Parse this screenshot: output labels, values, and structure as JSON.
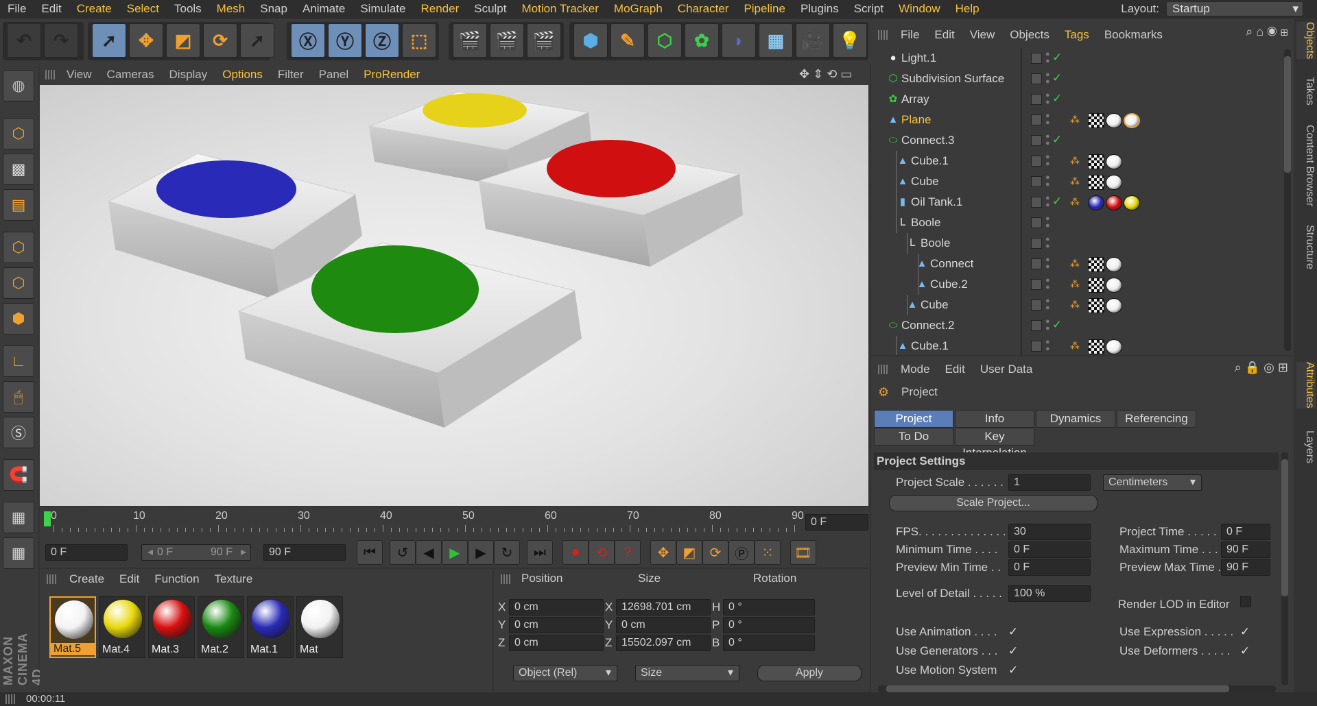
{
  "menubar": {
    "items": [
      "File",
      "Edit",
      "Create",
      "Select",
      "Tools",
      "Mesh",
      "Snap",
      "Animate",
      "Simulate",
      "Render",
      "Sculpt",
      "Motion Tracker",
      "MoGraph",
      "Character",
      "Pipeline",
      "Plugins",
      "Script",
      "Window",
      "Help"
    ],
    "highlighted": [
      "Create",
      "Select",
      "Mesh",
      "Render",
      "Motion Tracker",
      "MoGraph",
      "Character",
      "Pipeline",
      "Window",
      "Help"
    ],
    "layout_label": "Layout:",
    "layout_value": "Startup"
  },
  "viewport_menu": {
    "items": [
      "View",
      "Cameras",
      "Display",
      "Options",
      "Filter",
      "Panel",
      "ProRender"
    ],
    "highlighted": [
      "Options",
      "ProRender"
    ]
  },
  "scene": {
    "discs": [
      {
        "name": "blue-disc",
        "color": "#2a2ab8"
      },
      {
        "name": "yellow-disc",
        "color": "#e6d21a"
      },
      {
        "name": "red-disc",
        "color": "#d01010"
      },
      {
        "name": "green-disc",
        "color": "#1f8a10"
      }
    ]
  },
  "timeline": {
    "ticks": [
      "0",
      "10",
      "20",
      "30",
      "40",
      "50",
      "60",
      "70",
      "80",
      "90"
    ],
    "current_frame": "0 F"
  },
  "transport": {
    "start": "0 F",
    "range_start": "0 F",
    "range_end": "90 F",
    "end": "90 F"
  },
  "material_manager": {
    "menu": [
      "Create",
      "Edit",
      "Function",
      "Texture"
    ],
    "materials": [
      {
        "name": "Mat.5",
        "color": "#f2f2f2",
        "selected": true
      },
      {
        "name": "Mat.4",
        "color": "#e8d80a",
        "selected": false
      },
      {
        "name": "Mat.3",
        "color": "#d81010",
        "selected": false
      },
      {
        "name": "Mat.2",
        "color": "#1a8a12",
        "selected": false
      },
      {
        "name": "Mat.1",
        "color": "#2a2ab8",
        "selected": false
      },
      {
        "name": "Mat",
        "color": "#f2f2f2",
        "selected": false
      }
    ]
  },
  "coordinates": {
    "headers": {
      "position": "Position",
      "size": "Size",
      "rotation": "Rotation"
    },
    "rows": [
      {
        "axis": "X",
        "pos": "0 cm",
        "saxis": "X",
        "size": "12698.701 cm",
        "raxis": "H",
        "rot": "0 °"
      },
      {
        "axis": "Y",
        "pos": "0 cm",
        "saxis": "Y",
        "size": "0 cm",
        "raxis": "P",
        "rot": "0 °"
      },
      {
        "axis": "Z",
        "pos": "0 cm",
        "saxis": "Z",
        "size": "15502.097 cm",
        "raxis": "B",
        "rot": "0 °"
      }
    ],
    "mode_select": "Object (Rel)",
    "size_select": "Size",
    "apply": "Apply"
  },
  "object_manager": {
    "menu": [
      "File",
      "Edit",
      "View",
      "Objects",
      "Tags",
      "Bookmarks"
    ],
    "highlighted": [
      "Tags"
    ],
    "objects": [
      {
        "name": "Light.1",
        "indent": 0,
        "icon": "light-icon",
        "tags": [],
        "check": true,
        "selected": false
      },
      {
        "name": "Subdivision Surface",
        "indent": 0,
        "icon": "subdivision-icon",
        "tags": [],
        "check": true,
        "selected": false
      },
      {
        "name": "Array",
        "indent": 0,
        "icon": "array-icon",
        "tags": [],
        "check": true,
        "selected": false
      },
      {
        "name": "Plane",
        "indent": 0,
        "icon": "polygon-icon",
        "tags": [
          "phong",
          "checker",
          "#eeeeee",
          "#eeeeee"
        ],
        "check": false,
        "selected": true
      },
      {
        "name": "Connect.3",
        "indent": 0,
        "icon": "connect-icon",
        "tags": [],
        "check": true,
        "selected": false
      },
      {
        "name": "Cube.1",
        "indent": 1,
        "icon": "polygon-icon",
        "tags": [
          "phong",
          "checker",
          "#eeeeee"
        ],
        "check": false,
        "selected": false
      },
      {
        "name": "Cube",
        "indent": 1,
        "icon": "polygon-icon",
        "tags": [
          "phong",
          "checker",
          "#eeeeee"
        ],
        "check": false,
        "selected": false
      },
      {
        "name": "Oil Tank.1",
        "indent": 1,
        "icon": "oiltank-icon",
        "tags": [
          "phong",
          "#2a2ab8",
          "#d81010",
          "#e8d80a"
        ],
        "check": true,
        "selected": false
      },
      {
        "name": "Boole",
        "indent": 1,
        "icon": "boole-icon",
        "tags": [],
        "check": false,
        "selected": false
      },
      {
        "name": "Boole",
        "indent": 2,
        "icon": "boole-icon",
        "tags": [],
        "check": false,
        "selected": false
      },
      {
        "name": "Connect",
        "indent": 3,
        "icon": "polygon-icon",
        "tags": [
          "phong",
          "checker",
          "#eeeeee"
        ],
        "check": false,
        "selected": false
      },
      {
        "name": "Cube.2",
        "indent": 3,
        "icon": "polygon-icon",
        "tags": [
          "phong",
          "checker",
          "#eeeeee"
        ],
        "check": false,
        "selected": false
      },
      {
        "name": "Cube",
        "indent": 2,
        "icon": "polygon-icon",
        "tags": [
          "phong",
          "checker",
          "#eeeeee"
        ],
        "check": false,
        "selected": false
      },
      {
        "name": "Connect.2",
        "indent": 0,
        "icon": "connect-icon",
        "tags": [],
        "check": true,
        "selected": false
      },
      {
        "name": "Cube.1",
        "indent": 1,
        "icon": "polygon-icon",
        "tags": [
          "phong",
          "checker",
          "#eeeeee"
        ],
        "check": false,
        "selected": false
      }
    ]
  },
  "attribute_manager": {
    "menu": [
      "Mode",
      "Edit",
      "User Data"
    ],
    "object_title": "Project",
    "tabs_row1": [
      "Project Settings",
      "Info",
      "Dynamics",
      "Referencing"
    ],
    "tabs_row2": [
      "To Do",
      "Key Interpolation"
    ],
    "section": "Project Settings",
    "project_scale_label": "Project Scale . . . . . .",
    "project_scale_value": "1",
    "project_scale_unit": "Centimeters",
    "scale_project_button": "Scale Project...",
    "fields_left": [
      {
        "label": "FPS. . . . . . . . . . . . . .",
        "value": "30"
      },
      {
        "label": "Minimum Time . . . .",
        "value": "0 F"
      },
      {
        "label": "Preview Min Time . .",
        "value": "0 F"
      },
      {
        "label": "Level of Detail . . . . .",
        "value": "100 %"
      }
    ],
    "fields_right": [
      {
        "label": "Project Time . . . . . . .",
        "value": "0 F"
      },
      {
        "label": "Maximum Time . . . . .",
        "value": "90 F"
      },
      {
        "label": "Preview Max Time . .",
        "value": "90 F"
      }
    ],
    "render_lod_label": "Render LOD in Editor",
    "checks_left": [
      {
        "label": "Use Animation . . . .",
        "checked": true
      },
      {
        "label": "Use Generators . . .",
        "checked": true
      },
      {
        "label": "Use Motion System",
        "checked": true
      }
    ],
    "checks_right": [
      {
        "label": "Use Expression . . . . .",
        "checked": true
      },
      {
        "label": "Use Deformers . . . . .",
        "checked": true
      }
    ]
  },
  "side_tabs": [
    "Objects",
    "Takes",
    "Content Browser",
    "Structure",
    "Attributes",
    "Layers"
  ],
  "side_tabs_highlighted": [
    "Objects",
    "Attributes"
  ],
  "status": {
    "time": "00:00:11"
  },
  "brand": "MAXON CINEMA 4D"
}
